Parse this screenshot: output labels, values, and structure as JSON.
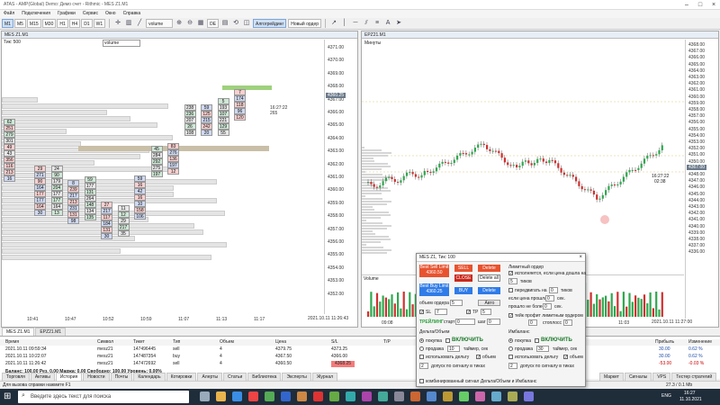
{
  "window": {
    "title": "ATAS - AMP(Global) Demo: Демо счет - Rithmic - MES Z1.M1"
  },
  "menu": [
    "Файл",
    "Подключения",
    "Графики",
    "Сервис",
    "Окно",
    "Справка"
  ],
  "toolbar": {
    "tfs": [
      "M1",
      "M5",
      "M15",
      "M30",
      "H1",
      "H4",
      "D1",
      "W1"
    ],
    "dd": "volume",
    "de": "DE",
    "alg": "Алгогрейдинг",
    "order": "Новый ордер"
  },
  "left_chart": {
    "tab": "MES Z1.M1",
    "header": "Тик: 500",
    "mode": "volume",
    "prices": [
      "4371.00",
      "4370.00",
      "4369.00",
      "4368.00",
      "4367.00",
      "4366.00",
      "4365.00",
      "4364.00",
      "4363.00",
      "4362.00",
      "4361.00",
      "4360.00",
      "4359.00",
      "4358.00",
      "4357.00",
      "4356.00",
      "4355.00",
      "4354.00",
      "4353.00",
      "4352.00"
    ],
    "price_tag": "4360.25",
    "timer": "16:27:22",
    "timer_vol": "265",
    "times": [
      "10:41",
      "10:47",
      "10:52",
      "10:59",
      "11:07",
      "11:13",
      "11:17"
    ],
    "datetime": "2021.10.11 11:26:43",
    "left_cells": [
      "62",
      "251",
      "279",
      "301",
      "49",
      "43",
      "356",
      "116",
      "213",
      "16"
    ],
    "cols": [
      [
        "29",
        "271",
        "90",
        "164",
        "177",
        "177",
        "164",
        "30"
      ],
      [
        "24",
        "90",
        "179",
        "204",
        "177",
        "177",
        "164",
        "13"
      ],
      [
        "8",
        "239",
        "217",
        "213",
        "231",
        "131",
        "98"
      ],
      [
        "59",
        "177",
        "131",
        "264",
        "148",
        "134",
        "135"
      ],
      [
        "27",
        "217",
        "117",
        "184",
        "131",
        "30"
      ],
      [
        "11",
        "12",
        "29",
        "217",
        "35"
      ],
      [
        "59",
        "16",
        "42",
        "16",
        "10",
        "158",
        "106"
      ],
      [
        "45",
        "284",
        "292",
        "275",
        "197"
      ],
      [
        "83",
        "276",
        "136",
        "197",
        "12"
      ],
      [
        "238",
        "236",
        "207",
        "26",
        "108"
      ],
      [
        "59",
        "125",
        "215",
        "242",
        "20"
      ],
      [
        "5",
        "193",
        "107",
        "221",
        "129",
        "55"
      ],
      [
        "7",
        "174",
        "118",
        "96",
        "120"
      ]
    ]
  },
  "right_chart": {
    "tab": "EPZ21.M1",
    "header": "Минуты",
    "volume_label": "Volume",
    "prices": [
      "4368.00",
      "4367.00",
      "4366.00",
      "4365.00",
      "4364.00",
      "4363.00",
      "4362.00",
      "4361.00",
      "4360.00",
      "4359.00",
      "4358.00",
      "4357.00",
      "4356.00",
      "4355.00",
      "4354.00",
      "4353.00",
      "4352.00",
      "4351.00",
      "4350.00",
      "4349.00",
      "4348.00",
      "4347.00",
      "4346.00",
      "4345.00",
      "4344.00",
      "4343.00",
      "4342.00",
      "4341.00",
      "4340.00",
      "4339.00",
      "4338.00",
      "4337.00",
      "4336.00"
    ],
    "price_tag": "4367.00",
    "timer": "16:27:22",
    "timer2": "02:38",
    "times": [
      "09:08",
      "10:02",
      "11:03"
    ],
    "datetime": "2021.10.11 11:27:00"
  },
  "bottom": {
    "tab1": "MES Z1.M1",
    "tab2": "EPZ21.M1",
    "headers": [
      "Время",
      "Символ",
      "Тикет",
      "Тип",
      "Объем",
      "Цена",
      "S/L",
      "T/P",
      "Прибыль",
      "Изменение"
    ],
    "rows": [
      [
        "2021.10.11 09:59:34",
        "mesz21",
        "147496445",
        "sell",
        "4",
        "4379.75",
        "4373.25",
        "",
        "30.00",
        "0.62 %"
      ],
      [
        "2021.10.11 10:22:07",
        "mesz21",
        "147487354",
        "buy",
        "4",
        "4367.50",
        "4366.00",
        "",
        "30.00",
        "0.62 %"
      ],
      [
        "2021.10.11 11:26:42",
        "mesz21",
        "147472692",
        "sell",
        "4",
        "4360.50",
        "4368.25",
        "",
        "-53.00",
        "-0.03 %"
      ]
    ],
    "summary": "Баланс: 100.00 Рез. 0.00 Маржа: 0.00 Свободно: 100.00 Уровень: 0.00%",
    "tabs": [
      "Торговля",
      "Активы",
      "История",
      "Новости",
      "Почты",
      "Календарь",
      "Котировки",
      "Алерты",
      "Статьи",
      "Библиотека",
      "Эксперты",
      "Журнал"
    ],
    "right_tabs": [
      "Маркет",
      "Сигналы",
      "VPS",
      "Тестер стратегий"
    ],
    "status_left": "Для вызова справки нажмите F1",
    "status_right": "27.3 / 0.1 Mb"
  },
  "dialog": {
    "title": "MES Z1, Тик: 100",
    "best_sell": "Best Sell Limit",
    "best_sell_price": "4360.50",
    "sell": "SELL",
    "delete": "Delete",
    "close": "CLOSE",
    "delete_all": "Delete all",
    "best_buy": "Best Buy Limit",
    "best_buy_price": "4360.25",
    "buy": "BUY",
    "delete2": "Delete",
    "vol_label": "объем ордера",
    "vol": "5",
    "auto": "Авто",
    "sl_label": "SL",
    "sl": "7",
    "tp_label": "TP",
    "tp": "5",
    "trail_label": "ТРЕЙЛИНГ",
    "start": "старт",
    "start_val": "0",
    "step": "шаг",
    "step_val": "0",
    "delta_title": "Дельта/Объем",
    "buy_lbl": "покупка",
    "enable": "ВКЛЮЧИТЬ",
    "sell_lbl": "продажа",
    "sell_val": "10",
    "timer": "таймер, сек",
    "use_delta": "использовать дельту",
    "volume_lbl": "объем",
    "delay": "допуск по сигналу в тиках",
    "combined": "комбинированный сигнал Дельта/Объем и Имбаланс",
    "pending": "Лимитный ордер",
    "pending2": "исполняется, если цена дошла на",
    "ticks": "тиков",
    "move": "передвигать на",
    "ticks2": "тиков",
    "price_pass": "если цена прошла",
    "sec": "сек.",
    "past": "прошло не более",
    "sec2": "сек.",
    "breakeven": "тейк профит лимитным ордером",
    "stop_lbl": "стоплосс",
    "stop_val": "0",
    "imb_title": "Имбаланс",
    "imb_buy": "покупка",
    "imb_enable": "ВКЛЮЧИТЬ",
    "imb_sell": "продажа",
    "imb_sell_val": "30",
    "imb_use": "использовать дельту",
    "imb_volume": "объем",
    "imb_delay": "допуск по сигналу в тиках"
  },
  "taskbar": {
    "search": "Введите здесь текст для поиска",
    "time": "16:27",
    "date": "11.10.2021",
    "lang": "ENG"
  }
}
